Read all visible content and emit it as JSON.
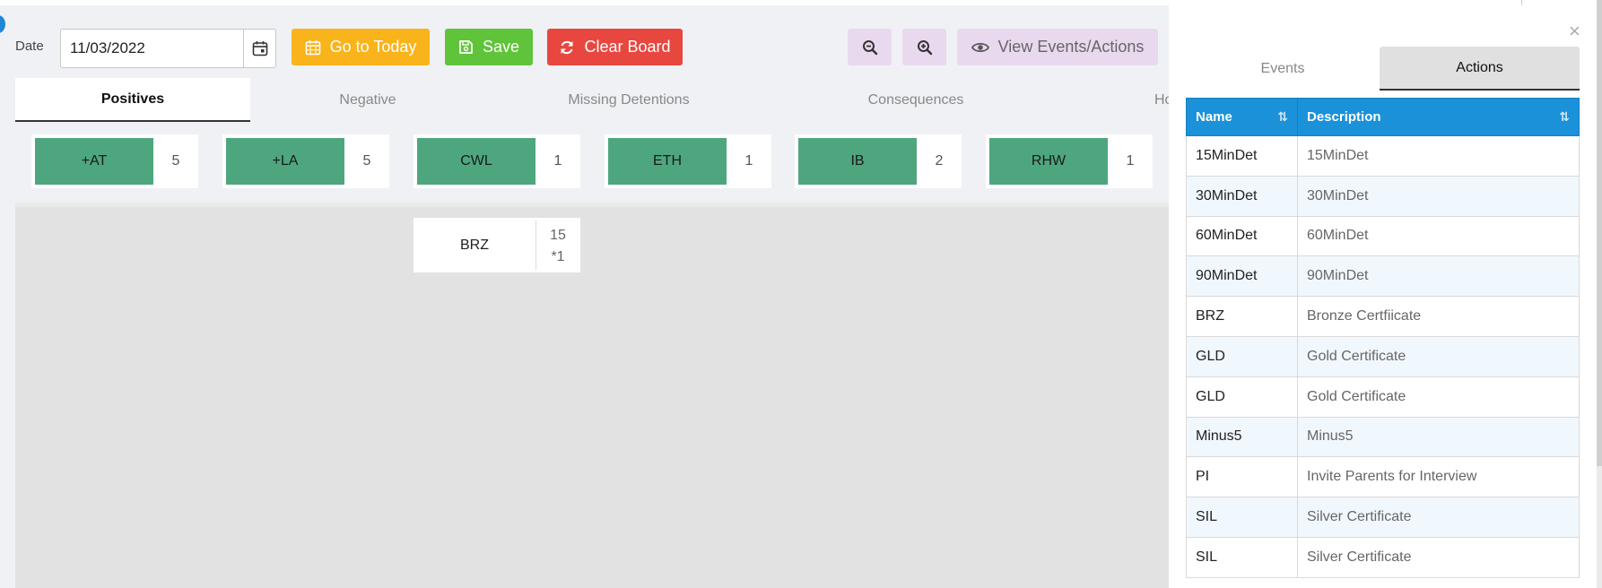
{
  "toolbar": {
    "date_label": "Date",
    "date_value": "11/03/2022",
    "go_today_label": "Go to Today",
    "save_label": "Save",
    "clear_label": "Clear Board",
    "view_label": "View Events/Actions"
  },
  "tabs": {
    "positives": "Positives",
    "negative": "Negative",
    "missing": "Missing Detentions",
    "consequences": "Consequences",
    "ho": "Ho"
  },
  "cards": [
    {
      "label": "+AT",
      "count": "5"
    },
    {
      "label": "+LA",
      "count": "5"
    },
    {
      "label": "CWL",
      "count": "1"
    },
    {
      "label": "ETH",
      "count": "1"
    },
    {
      "label": "IB",
      "count": "2"
    },
    {
      "label": "RHW",
      "count": "1"
    }
  ],
  "board": {
    "card_label": "BRZ",
    "count_line1": "15",
    "count_line2": "*1"
  },
  "panel": {
    "close": "×",
    "tab_events": "Events",
    "tab_actions": "Actions",
    "col_name": "Name",
    "col_description": "Description",
    "rows": [
      {
        "name": "15MinDet",
        "description": "15MinDet"
      },
      {
        "name": "30MinDet",
        "description": "30MinDet"
      },
      {
        "name": "60MinDet",
        "description": "60MinDet"
      },
      {
        "name": "90MinDet",
        "description": "90MinDet"
      },
      {
        "name": "BRZ",
        "description": "Bronze Certfiicate"
      },
      {
        "name": "GLD",
        "description": "Gold Certificate"
      },
      {
        "name": "GLD",
        "description": "Gold Certificate"
      },
      {
        "name": "Minus5",
        "description": "Minus5"
      },
      {
        "name": "PI",
        "description": "Invite Parents for Interview"
      },
      {
        "name": "SIL",
        "description": "Silver Certificate"
      },
      {
        "name": "SIL",
        "description": "Silver Certificate"
      }
    ]
  },
  "colors": {
    "accent_blue": "#1a91d8",
    "card_green": "#4ea67f",
    "today_orange": "#f9b31b",
    "save_green": "#5fc43a",
    "clear_red": "#e8473f"
  },
  "icons": {
    "calendar": "calendar-icon",
    "save": "floppy-icon",
    "refresh": "refresh-icon",
    "zoom_out": "zoom-out-icon",
    "zoom_in": "zoom-in-icon",
    "eye": "eye-icon"
  }
}
